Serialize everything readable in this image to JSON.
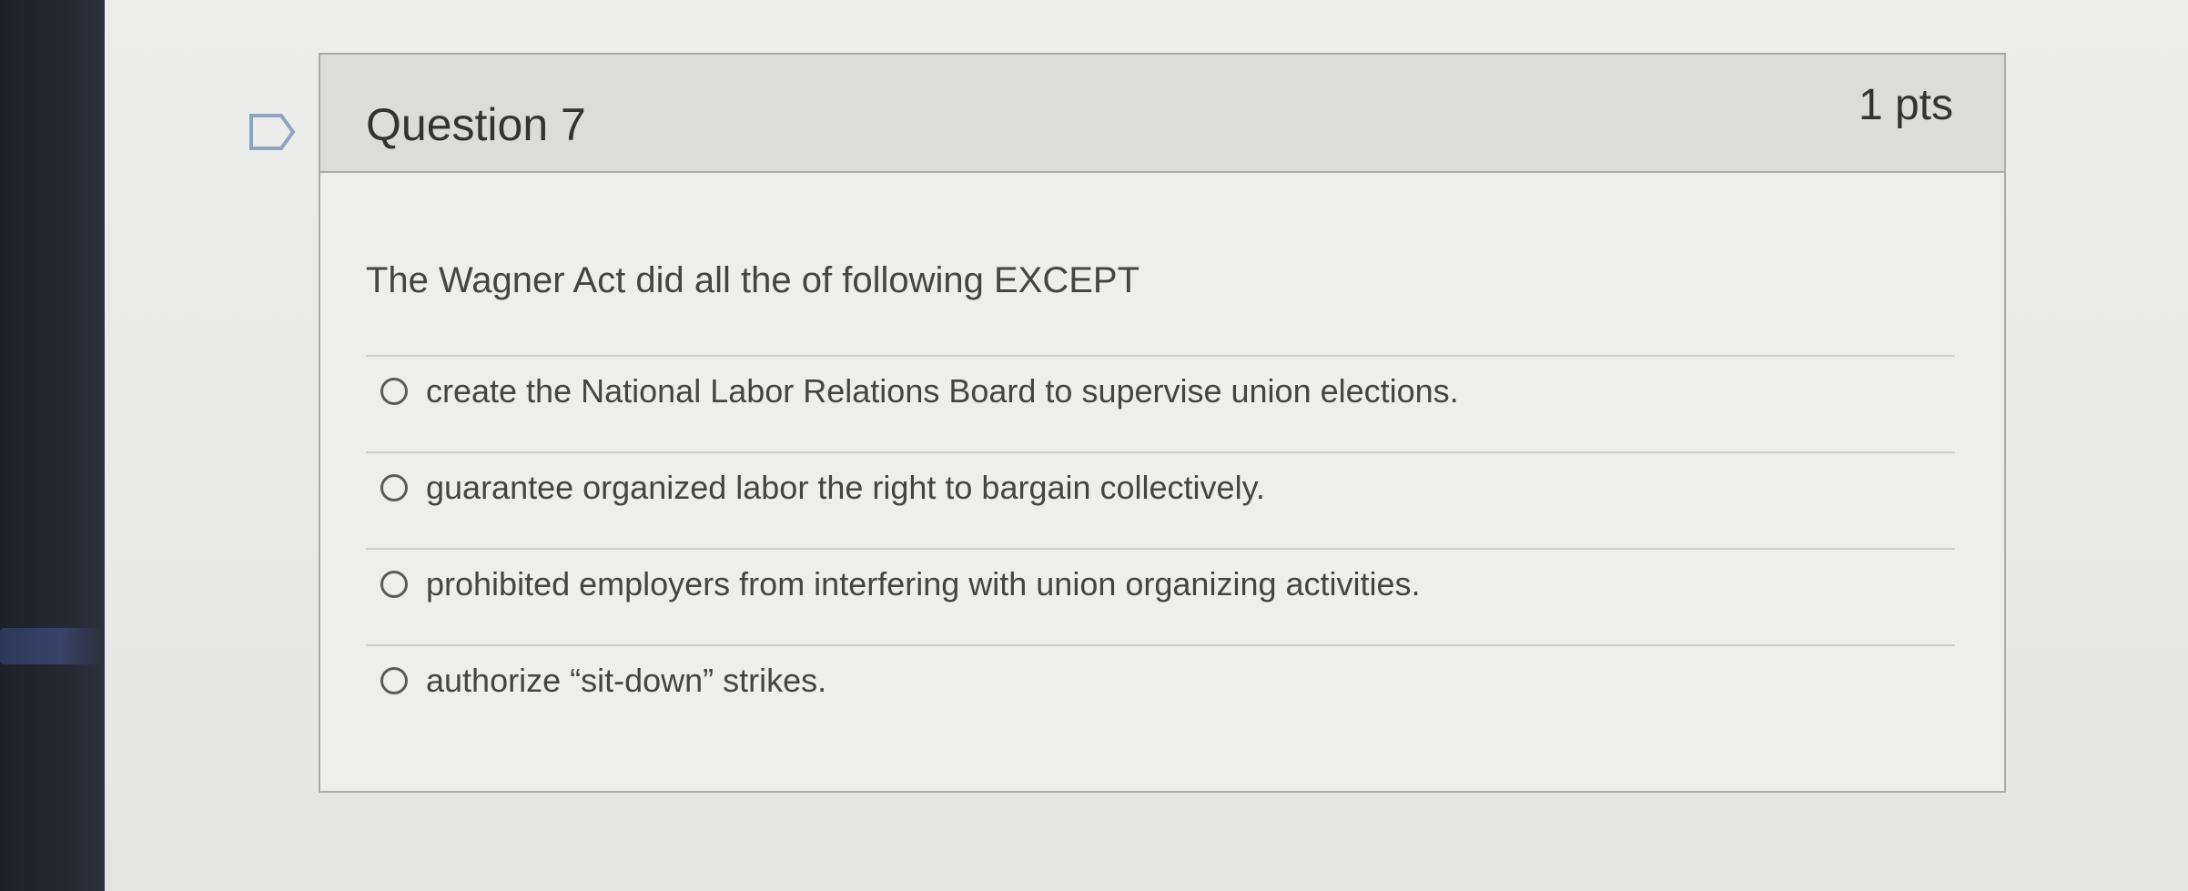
{
  "question": {
    "title": "Question 7",
    "points": "1 pts",
    "prompt": "The Wagner Act did all the of following EXCEPT",
    "answers": [
      "create the National Labor Relations Board to supervise union elections.",
      "guarantee organized labor the right to bargain collectively.",
      "prohibited employers from interfering with union organizing activities.",
      "authorize “sit-down” strikes."
    ]
  },
  "icons": {
    "bookmark": "bookmark-flag-icon",
    "radio": "radio-button-icon"
  },
  "colors": {
    "sidebar": "#1f232c",
    "header_bg": "#dcdcda",
    "card_bg": "#eeeeec",
    "border": "#a9a9a9",
    "text": "#333333"
  }
}
